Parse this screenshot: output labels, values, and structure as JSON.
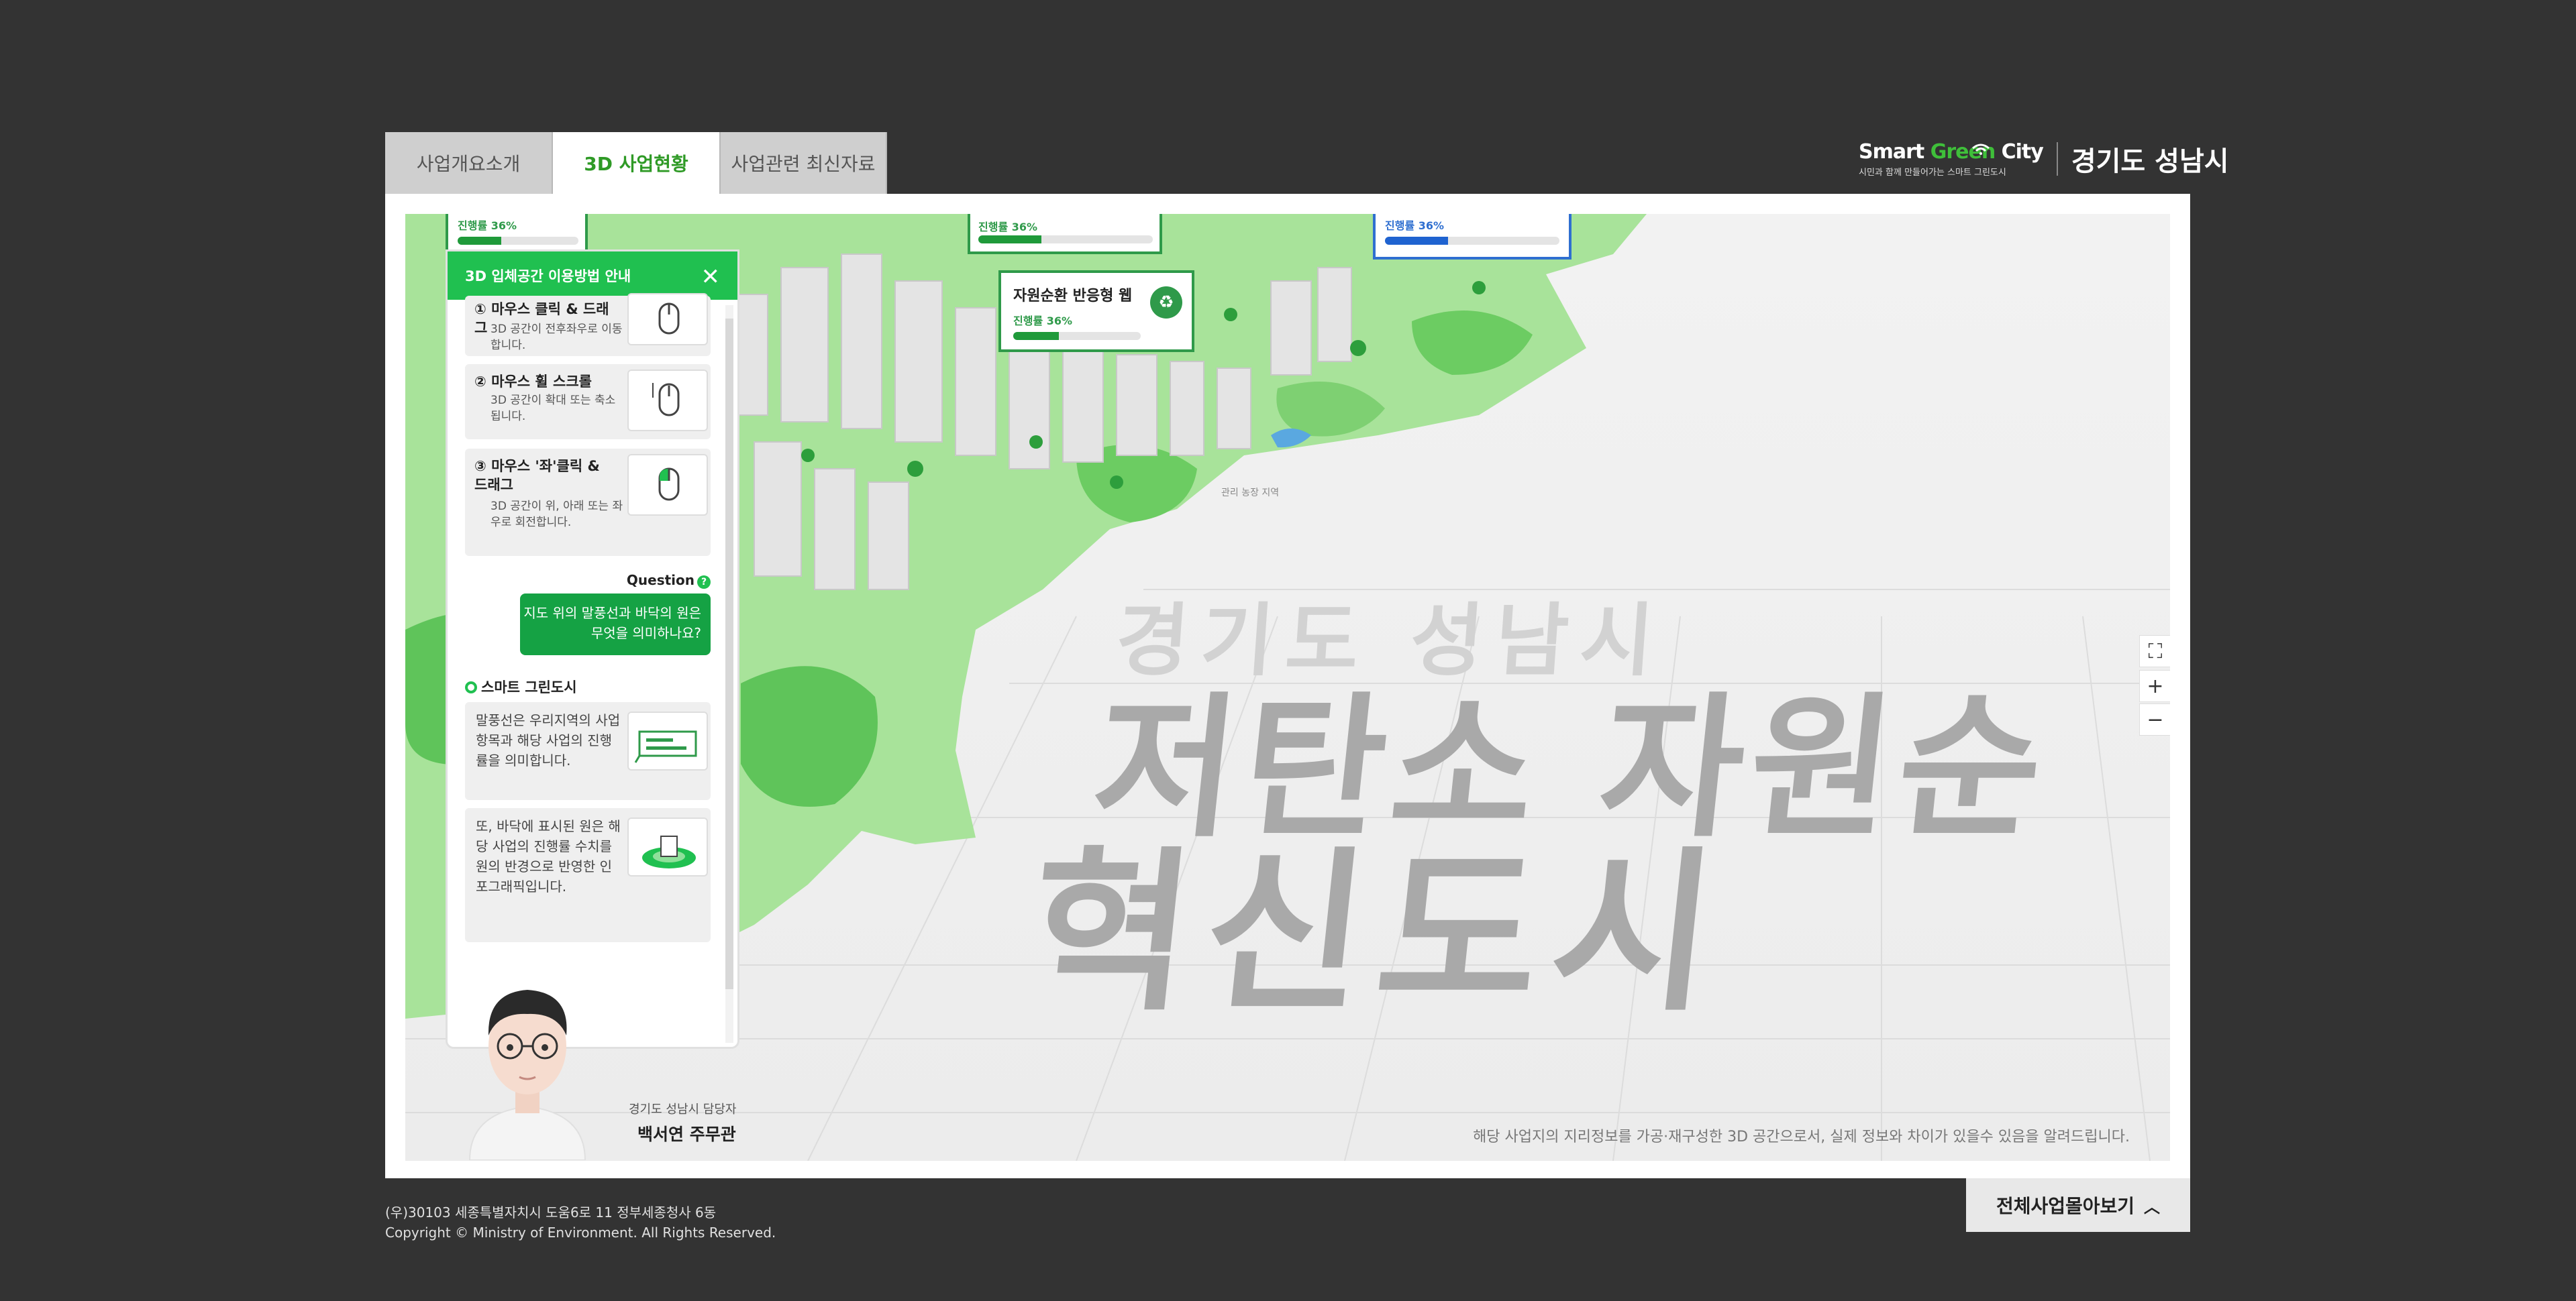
{
  "tabs": [
    {
      "label": "사업개요소개"
    },
    {
      "label": "3D 사업현황"
    },
    {
      "label": "사업관련 최신자료"
    }
  ],
  "logo": {
    "smart": "Smart ",
    "green": "Green",
    "city": " City",
    "tagline": "시민과 함께 만들어가는 스마트 그린도시",
    "region": "경기도 성남시"
  },
  "map": {
    "heading_small": "경기도 성남시",
    "heading_line1": "저탄소 자원순",
    "heading_line2": "혁신도시",
    "notice": "해당 사업지의 지리정보를 가공·재구성한 3D 공간으로서, 실제 정보와 차이가 있을수 있음을 알려드립니다.",
    "place_label": "관리 농장 지역",
    "balloons": [
      {
        "progress_label": "진행률 36%",
        "progress": 0.36
      },
      {
        "progress_label": "진행률 36%",
        "progress": 0.36
      },
      {
        "title": "자원순환 반응형 웹",
        "progress_label": "진행률 36%",
        "progress": 0.36
      },
      {
        "progress_label": "진행률 36%",
        "progress": 0.36
      }
    ]
  },
  "guide": {
    "title": "3D 입체공간 이용방법 안내",
    "cards": [
      {
        "head": "① 마우스 클릭 & 드래그",
        "desc": "3D 공간이 전후좌우로 이동합니다."
      },
      {
        "head": "② 마우스 휠 스크롤",
        "desc": "3D 공간이 확대 또는 축소됩니다."
      },
      {
        "head": "③ 마우스 '좌'클릭 & 드래그",
        "desc": "3D 공간이 위, 아래 또는 좌우로 회전합니다."
      }
    ],
    "question_label": "Question",
    "question": "지도 위의 말풍선과 바닥의 원은 무엇을 의미하나요?",
    "answer_label": "스마트 그린도시",
    "answers": [
      {
        "text": "말풍선은 우리지역의 사업항목과 해당 사업의 진행률을 의미합니다."
      },
      {
        "text": "또, 바닥에 표시된 원은 해당 사업의 진행률 수치를 원의 반경으로 반영한 인포그래픽입니다."
      }
    ]
  },
  "manager": {
    "role": "경기도 성남시 담당자",
    "name": "백서연 주무관"
  },
  "footer": {
    "address": "(우)30103 세종특별자치시 도움6로 11 정부세종청사 6동",
    "copyright": "Copyright © Ministry of Environment. All Rights Reserved.",
    "all_projects_button": "전체사업몰아보기"
  },
  "colors": {
    "accent_green": "#20c050",
    "dark_green": "#15a244",
    "background": "#333333",
    "tab_active_text": "#2f9a26"
  }
}
